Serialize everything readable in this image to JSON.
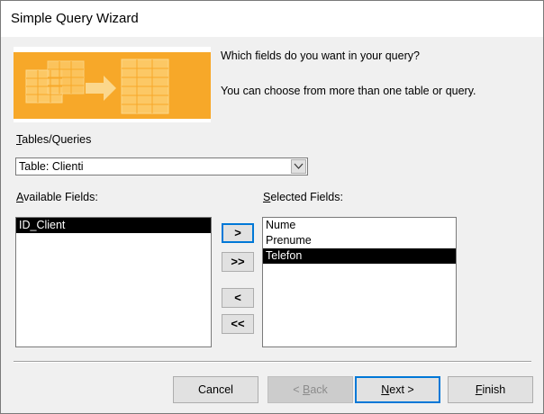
{
  "window": {
    "title": "Simple Query Wizard"
  },
  "prompt": {
    "question": "Which fields do you want in your query?",
    "hint": "You can choose from more than one table or query."
  },
  "tables_queries": {
    "label_mnemonic": "T",
    "label_rest": "ables/Queries",
    "selected": "Table: Clienti"
  },
  "available_fields": {
    "label_mnemonic": "A",
    "label_rest": "vailable Fields:",
    "items": [
      "ID_Client"
    ],
    "selected_index": 0
  },
  "selected_fields": {
    "label_mnemonic": "S",
    "label_rest": "elected Fields:",
    "items": [
      "Nume",
      "Prenume",
      "Telefon"
    ],
    "selected_index": 2
  },
  "move_buttons": {
    "add_one": ">",
    "add_all": ">>",
    "remove_one": "<",
    "remove_all": "<<"
  },
  "footer": {
    "cancel": "Cancel",
    "back_mnemonic": "B",
    "back_pre": "< ",
    "back_rest": "ack",
    "next_mnemonic": "N",
    "next_rest": "ext >",
    "finish_mnemonic": "F",
    "finish_rest": "inish"
  },
  "colors": {
    "selection": "#000000",
    "focus_border": "#0078d7",
    "illustration_orange": "#f7a829"
  }
}
